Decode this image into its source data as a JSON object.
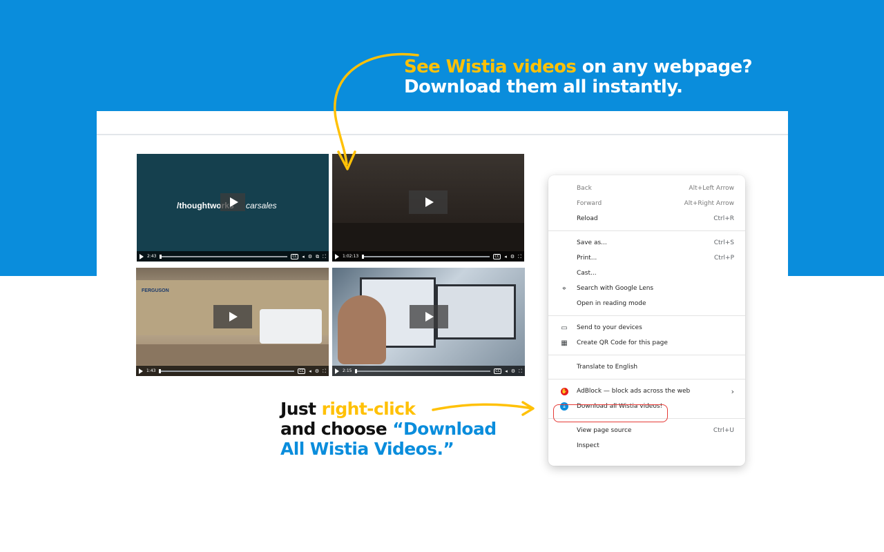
{
  "headline": {
    "highlight": "See Wistia videos",
    "line1_rest": " on any webpage?",
    "line2": "Download them all instantly."
  },
  "videos": [
    {
      "time": "2:43",
      "logo_left": "/thoughtworks",
      "logo_right": "carsales"
    },
    {
      "time": "1:02:13"
    },
    {
      "time": "1:43",
      "sign": "FERGUSON"
    },
    {
      "time": "2:15"
    }
  ],
  "callout": {
    "line1_plain": "Just ",
    "line1_highlight": "right-click",
    "line2_plain": "and choose ",
    "line2_highlight": "“Download",
    "line3_highlight": "All Wistia Videos.”"
  },
  "context_menu": {
    "group1": [
      {
        "label": "Back",
        "shortcut": "Alt+Left Arrow",
        "disabled": true
      },
      {
        "label": "Forward",
        "shortcut": "Alt+Right Arrow",
        "disabled": true
      },
      {
        "label": "Reload",
        "shortcut": "Ctrl+R",
        "disabled": false
      }
    ],
    "group2": [
      {
        "label": "Save as...",
        "shortcut": "Ctrl+S"
      },
      {
        "label": "Print...",
        "shortcut": "Ctrl+P"
      },
      {
        "label": "Cast..."
      },
      {
        "label": "Search with Google Lens",
        "icon": "google-lens-icon"
      },
      {
        "label": "Open in reading mode"
      }
    ],
    "group3": [
      {
        "label": "Send to your devices",
        "icon": "devices-icon"
      },
      {
        "label": "Create QR Code for this page",
        "icon": "qr-code-icon"
      }
    ],
    "group4": [
      {
        "label": "Translate to English"
      }
    ],
    "group5": [
      {
        "label": "AdBlock — block ads across the web",
        "icon": "adblock-icon",
        "submenu": true
      },
      {
        "label": "Download all Wistia videos!",
        "icon": "wistia-download-icon",
        "highlighted": true
      }
    ],
    "group6": [
      {
        "label": "View page source",
        "shortcut": "Ctrl+U"
      },
      {
        "label": "Inspect"
      }
    ]
  },
  "colors": {
    "brand_blue": "#0a8ddc",
    "accent_yellow": "#ffc107",
    "highlight_ring": "#e53935"
  }
}
